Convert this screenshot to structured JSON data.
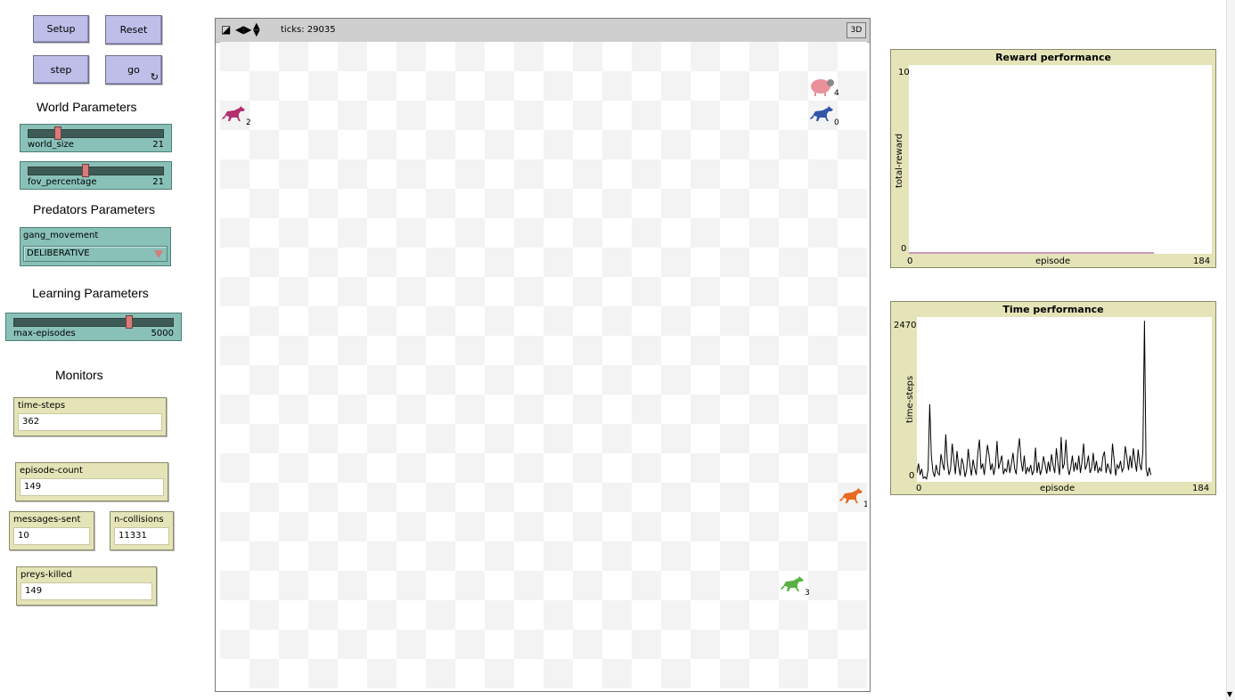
{
  "buttons": {
    "setup": "Setup",
    "reset": "Reset",
    "step": "step",
    "go": "go",
    "go_forever_glyph": "↻"
  },
  "sections": {
    "world": "World Parameters",
    "predators": "Predators Parameters",
    "learning": "Learning Parameters",
    "monitors": "Monitors"
  },
  "sliders": {
    "world_size": {
      "name": "world_size",
      "value": "21",
      "fraction": 0.21
    },
    "fov_percentage": {
      "name": "fov_percentage",
      "value": "21",
      "fraction": 0.42
    },
    "max_episodes": {
      "name": "max-episodes",
      "value": "5000",
      "fraction": 0.73
    }
  },
  "chooser": {
    "name": "gang_movement",
    "value": "DELIBERATIVE"
  },
  "monitors": {
    "time_steps": {
      "name": "time-steps",
      "value": "362"
    },
    "episode_count": {
      "name": "episode-count",
      "value": "149"
    },
    "messages_sent": {
      "name": "messages-sent",
      "value": "10"
    },
    "n_collisions": {
      "name": "n-collisions",
      "value": "11331"
    },
    "preys_killed": {
      "name": "preys-killed",
      "value": "149"
    }
  },
  "view": {
    "ticks": "ticks: 29035",
    "btn_3d": "3D",
    "grid_size": 22,
    "agents": [
      {
        "kind": "prey",
        "label": "4",
        "color": "#e9909b",
        "col": 20,
        "row": 1
      },
      {
        "kind": "wolf",
        "label": "2",
        "color": "#b0306e",
        "col": 0,
        "row": 2
      },
      {
        "kind": "wolf",
        "label": "0",
        "color": "#3355aa",
        "col": 20,
        "row": 2
      },
      {
        "kind": "wolf",
        "label": "1",
        "color": "#e56b1f",
        "col": 21,
        "row": 15
      },
      {
        "kind": "wolf",
        "label": "3",
        "color": "#58b142",
        "col": 19,
        "row": 18
      }
    ]
  },
  "chart_data": [
    {
      "type": "line",
      "title": "Reward performance",
      "xlabel": "episode",
      "ylabel": "total-reward",
      "xlim": [
        0,
        184
      ],
      "ylim": [
        0,
        10
      ],
      "x_tick_labels": [
        "0",
        "184"
      ],
      "y_tick_labels": [
        "0",
        "10"
      ],
      "series": [
        {
          "color": "#a0307a",
          "x": [
            0,
            149
          ],
          "values": [
            0,
            0
          ]
        }
      ]
    },
    {
      "type": "line",
      "title": "Time performance",
      "xlabel": "episode",
      "ylabel": "time-steps",
      "xlim": [
        0,
        184
      ],
      "ylim": [
        0,
        2470
      ],
      "x_tick_labels": [
        "0",
        "184"
      ],
      "y_tick_labels": [
        "0",
        "2470"
      ],
      "series": [
        {
          "color": "#000000",
          "values": [
            120,
            260,
            90,
            180,
            40,
            60,
            30,
            170,
            1150,
            380,
            140,
            60,
            240,
            120,
            90,
            400,
            260,
            160,
            700,
            280,
            90,
            180,
            560,
            320,
            100,
            450,
            220,
            80,
            340,
            250,
            60,
            160,
            480,
            250,
            80,
            320,
            190,
            90,
            420,
            620,
            180,
            260,
            90,
            300,
            540,
            380,
            160,
            260,
            90,
            220,
            600,
            180,
            280,
            380,
            100,
            180,
            140,
            320,
            120,
            260,
            420,
            180,
            100,
            440,
            640,
            300,
            140,
            380,
            100,
            200,
            140,
            240,
            90,
            160,
            500,
            120,
            280,
            90,
            180,
            370,
            240,
            110,
            290,
            140,
            400,
            230,
            120,
            490,
            260,
            90,
            660,
            180,
            260,
            620,
            220,
            90,
            200,
            380,
            140,
            280,
            160,
            380,
            120,
            290,
            560,
            170,
            240,
            380,
            120,
            190,
            420,
            150,
            300,
            120,
            200,
            140,
            360,
            440,
            120,
            260,
            180,
            100,
            560,
            320,
            80,
            240,
            190,
            300,
            140,
            200,
            520,
            350,
            160,
            380,
            190,
            490,
            300,
            140,
            470,
            260,
            160,
            440,
            2400,
            180,
            70,
            200,
            90
          ]
        }
      ]
    }
  ]
}
